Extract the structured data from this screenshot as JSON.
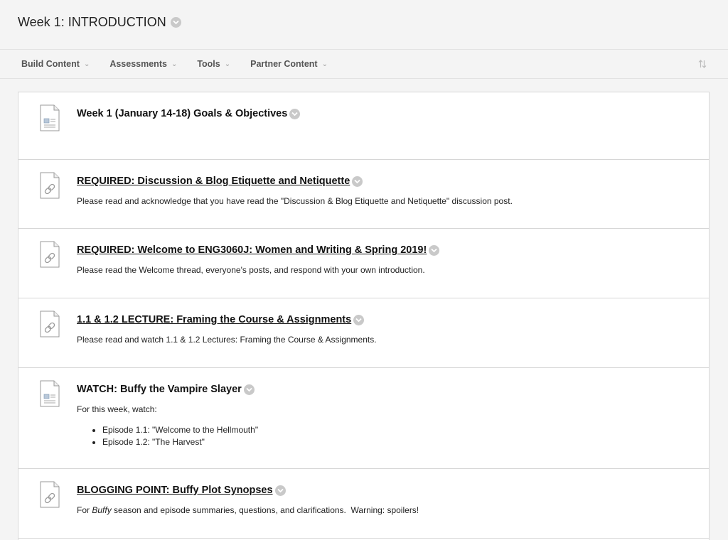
{
  "page": {
    "title": "Week 1: INTRODUCTION"
  },
  "toolbar": {
    "menus": [
      {
        "label": "Build Content"
      },
      {
        "label": "Assessments"
      },
      {
        "label": "Tools"
      },
      {
        "label": "Partner Content"
      }
    ],
    "sort_icon": "sort-arrows-icon"
  },
  "items": [
    {
      "type": "item",
      "icon": "document-icon",
      "title": "Week 1 (January 14-18) Goals & Objectives",
      "is_link": false
    },
    {
      "type": "link",
      "icon": "link-document-icon",
      "title": "REQUIRED: Discussion & Blog Etiquette and Netiquette",
      "is_link": true,
      "description": "Please read and acknowledge that you have read the \"Discussion & Blog Etiquette and Netiquette\" discussion post."
    },
    {
      "type": "link",
      "icon": "link-document-icon",
      "title": "REQUIRED: Welcome to ENG3060J: Women and Writing & Spring 2019!",
      "is_link": true,
      "description": "Please read the Welcome thread, everyone's posts, and respond with your own introduction."
    },
    {
      "type": "link",
      "icon": "link-document-icon",
      "title": "1.1 & 1.2 LECTURE: Framing the Course & Assignments",
      "is_link": true,
      "description": "Please read and watch 1.1 & 1.2 Lectures: Framing the Course & Assignments."
    },
    {
      "type": "item",
      "icon": "document-icon",
      "title": "WATCH: Buffy the Vampire Slayer",
      "is_link": false,
      "description": "For this week, watch:",
      "bullets": [
        "Episode 1.1: \"Welcome to the Hellmouth\"",
        "Episode 1.2: \"The Harvest\""
      ]
    },
    {
      "type": "link",
      "icon": "link-document-icon",
      "title": "BLOGGING POINT: Buffy Plot Synopses",
      "is_link": true,
      "description_prefix": "For ",
      "description_em": "Buffy",
      "description_suffix": " season and episode summaries, questions, and clarifications.  Warning: spoilers!"
    }
  ]
}
